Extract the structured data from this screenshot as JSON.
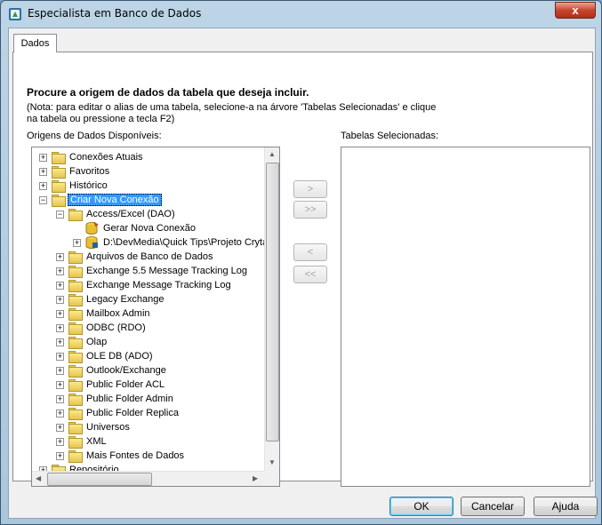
{
  "window": {
    "title": "Especialista em Banco de Dados",
    "close_label": "x"
  },
  "tabs": [
    {
      "label": "Dados"
    }
  ],
  "panel": {
    "instruction": "Procure a origem de dados da tabela que deseja incluir.",
    "note_line1": "(Nota: para editar o alias de uma tabela, selecione-a na árvore 'Tabelas Selecionadas' e clique",
    "note_line2": "na tabela ou pressione a tecla F2)",
    "available_label": "Origens de Dados Disponíveis:",
    "selected_label": "Tabelas Selecionadas:"
  },
  "tree": [
    {
      "label": "Conexões Atuais",
      "expander": "+"
    },
    {
      "label": "Favoritos",
      "expander": "+"
    },
    {
      "label": "Histórico",
      "expander": "+"
    },
    {
      "label": "Criar Nova Conexão",
      "expander": "−",
      "selected": true
    },
    {
      "label": "Access/Excel (DAO)",
      "expander": "−"
    },
    {
      "label": "Gerar Nova Conexão",
      "expander": ""
    },
    {
      "label": "D:\\DevMedia\\Quick Tips\\Projeto Cryta",
      "expander": "+"
    },
    {
      "label": "Arquivos de Banco de Dados",
      "expander": "+"
    },
    {
      "label": "Exchange 5.5 Message Tracking Log",
      "expander": "+"
    },
    {
      "label": "Exchange Message Tracking Log",
      "expander": "+"
    },
    {
      "label": "Legacy Exchange",
      "expander": "+"
    },
    {
      "label": "Mailbox Admin",
      "expander": "+"
    },
    {
      "label": "ODBC (RDO)",
      "expander": "+"
    },
    {
      "label": "Olap",
      "expander": "+"
    },
    {
      "label": "OLE DB (ADO)",
      "expander": "+"
    },
    {
      "label": "Outlook/Exchange",
      "expander": "+"
    },
    {
      "label": "Public Folder ACL",
      "expander": "+"
    },
    {
      "label": "Public Folder Admin",
      "expander": "+"
    },
    {
      "label": "Public Folder Replica",
      "expander": "+"
    },
    {
      "label": "Universos",
      "expander": "+"
    },
    {
      "label": "XML",
      "expander": "+"
    },
    {
      "label": "Mais Fontes de Dados",
      "expander": "+"
    },
    {
      "label": "Repositório",
      "expander": "+"
    }
  ],
  "move_buttons": {
    "add": ">",
    "add_all": ">>",
    "remove": "<",
    "remove_all": "<<"
  },
  "buttons": {
    "ok": "OK",
    "cancel": "Cancelar",
    "help": "Ajuda"
  }
}
